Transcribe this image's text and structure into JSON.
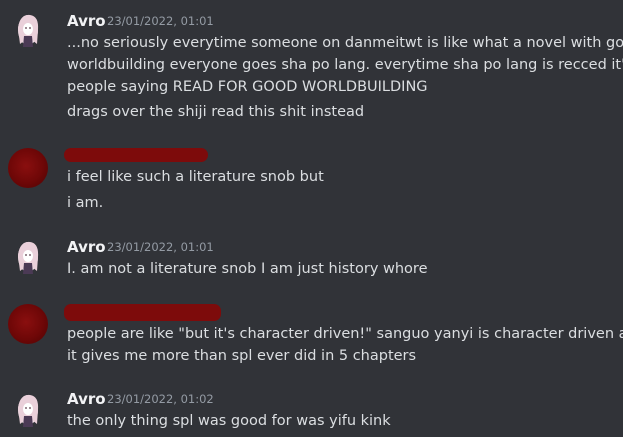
{
  "messages": [
    {
      "author": "Avro",
      "timestamp": "23/01/2022, 01:01",
      "lines": [
        "...no seriously everytime someone on danmeitwt is like what a novel with good",
        "worldbuilding everyone goes sha po lang. everytime sha po lang is recced it's",
        "people saying READ FOR GOOD WORLDBUILDING",
        "drags over the shiji read this shit instead"
      ]
    },
    {
      "author": "",
      "timestamp": "",
      "lines": [
        "i feel like such a literature snob but",
        "i am."
      ]
    },
    {
      "author": "Avro",
      "timestamp": "23/01/2022, 01:01",
      "lines": [
        "I. am not a literature snob I am just history whore"
      ]
    },
    {
      "author": "",
      "timestamp": "",
      "lines": [
        "people are like \"but it's character driven!\" sanguo yanyi is character driven and",
        "it gives me more than spl ever did in 5 chapters"
      ]
    },
    {
      "author": "Avro",
      "timestamp": "23/01/2022, 01:02",
      "lines": [
        "the only thing spl was good for was yifu kink"
      ]
    }
  ],
  "colors": {
    "background": "#313338",
    "author": "#f2f3f5",
    "timestamp": "#949ba4",
    "text": "#dbdee1",
    "redaction": "#7d0b0b"
  }
}
